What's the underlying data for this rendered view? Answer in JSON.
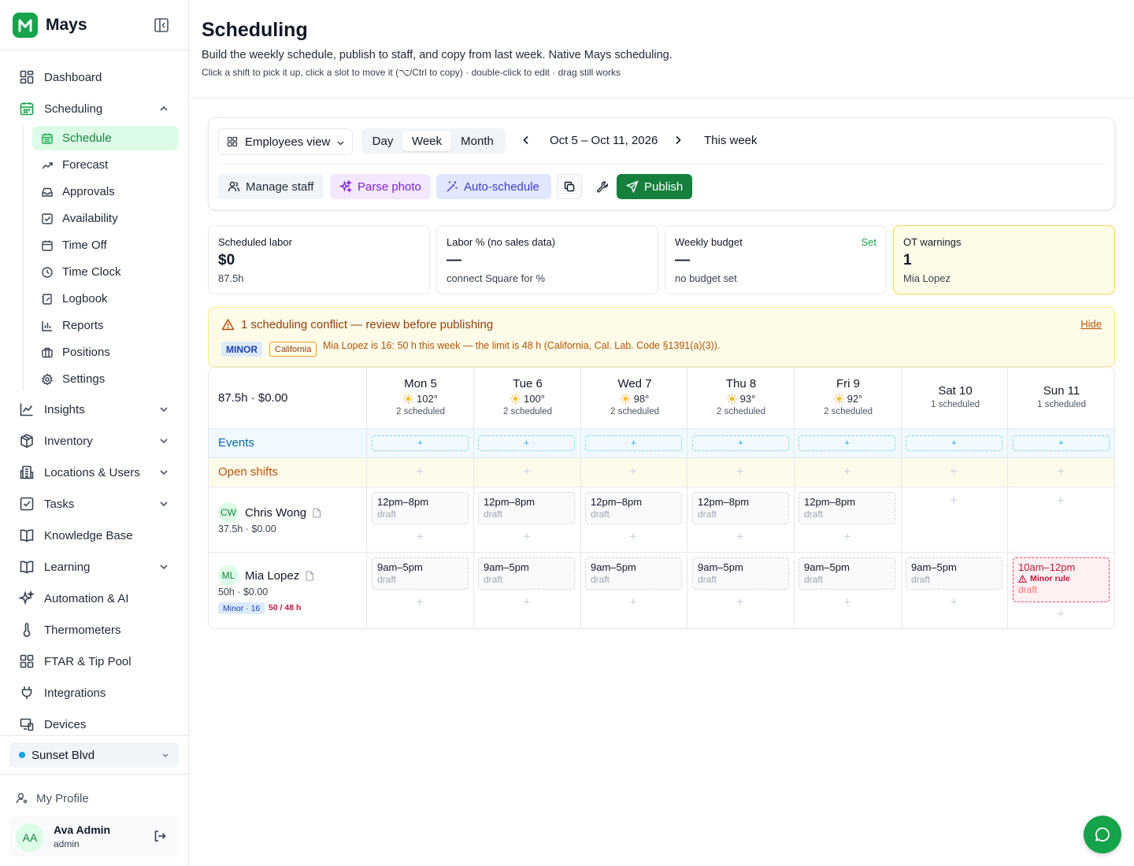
{
  "app": {
    "name": "Mays",
    "accent": "#16a34a"
  },
  "sidebar": {
    "items": [
      {
        "label": "Dashboard",
        "icon": "dashboard-icon"
      },
      {
        "label": "Scheduling",
        "icon": "calendar-icon",
        "expanded": true
      },
      {
        "label": "Insights",
        "icon": "chart-line-icon"
      },
      {
        "label": "Inventory",
        "icon": "box-icon"
      },
      {
        "label": "Locations & Users",
        "icon": "building-icon"
      },
      {
        "label": "Tasks",
        "icon": "checkbox-icon"
      },
      {
        "label": "Knowledge Base",
        "icon": "book-icon"
      },
      {
        "label": "Learning",
        "icon": "book-open-icon"
      },
      {
        "label": "Automation & AI",
        "icon": "sparkles-icon"
      },
      {
        "label": "Thermometers",
        "icon": "thermometer-icon"
      },
      {
        "label": "FTAR & Tip Pool",
        "icon": "grid-icon"
      },
      {
        "label": "Integrations",
        "icon": "plug-icon"
      },
      {
        "label": "Devices",
        "icon": "devices-icon"
      }
    ],
    "scheduling_sub": [
      {
        "label": "Schedule",
        "icon": "calendar-icon",
        "active": true
      },
      {
        "label": "Forecast",
        "icon": "trend-up-icon"
      },
      {
        "label": "Approvals",
        "icon": "inbox-icon"
      },
      {
        "label": "Availability",
        "icon": "checkbox-icon"
      },
      {
        "label": "Time Off",
        "icon": "calendar-icon"
      },
      {
        "label": "Time Clock",
        "icon": "clock-icon"
      },
      {
        "label": "Logbook",
        "icon": "notebook-icon"
      },
      {
        "label": "Reports",
        "icon": "bar-chart-icon"
      },
      {
        "label": "Positions",
        "icon": "briefcase-icon"
      },
      {
        "label": "Settings",
        "icon": "gear-icon"
      }
    ],
    "location": "Sunset Blvd",
    "my_profile": "My Profile",
    "user": {
      "initials": "AA",
      "name": "Ava Admin",
      "role": "admin"
    }
  },
  "page": {
    "title": "Scheduling",
    "subtitle": "Build the weekly schedule, publish to staff, and copy from last week. Native Mays scheduling.",
    "hint": "Click a shift to pick it up, click a slot to move it (⌥/Ctrl to copy) · double-click to edit · drag still works"
  },
  "toolbar": {
    "view": "Employees view",
    "modes": [
      "Day",
      "Week",
      "Month"
    ],
    "active_mode": "Week",
    "date_range": "Oct 5 – Oct 11, 2026",
    "this_week": "This week",
    "manage": "Manage staff",
    "parse": "Parse photo",
    "auto": "Auto-schedule",
    "publish": "Publish"
  },
  "stats": [
    {
      "label": "Scheduled labor",
      "value": "$0",
      "sub": "87.5h"
    },
    {
      "label": "Labor % (no sales data)",
      "value": "—",
      "sub": "connect Square for %"
    },
    {
      "label": "Weekly budget",
      "value": "—",
      "sub": "no budget set",
      "action": "Set"
    },
    {
      "label": "OT warnings",
      "value": "1",
      "sub": "Mia Lopez"
    }
  ],
  "conflict": {
    "title": "1 scheduling conflict — review before publishing",
    "hide": "Hide",
    "badge": "MINOR",
    "state": "California",
    "message": "Mia Lopez is 16: 50 h this week — the limit is 48 h (California, Cal. Lab. Code §1391(a)(3))."
  },
  "grid": {
    "total": "87.5h · $0.00",
    "days": [
      {
        "name": "Mon 5",
        "weather": "102°",
        "scheduled": "2 scheduled"
      },
      {
        "name": "Tue 6",
        "weather": "100°",
        "scheduled": "2 scheduled"
      },
      {
        "name": "Wed 7",
        "weather": "98°",
        "scheduled": "2 scheduled"
      },
      {
        "name": "Thu 8",
        "weather": "93°",
        "scheduled": "2 scheduled"
      },
      {
        "name": "Fri 9",
        "weather": "92°",
        "scheduled": "2 scheduled"
      },
      {
        "name": "Sat 10",
        "weather": "",
        "scheduled": "1 scheduled"
      },
      {
        "name": "Sun 11",
        "weather": "",
        "scheduled": "1 scheduled"
      }
    ],
    "events_label": "Events",
    "open_label": "Open shifts",
    "slot_plus": "+",
    "employees": [
      {
        "initials": "CW",
        "name": "Chris Wong",
        "meta": "37.5h · $0.00",
        "shifts": [
          {
            "time": "12pm–8pm",
            "status": "draft"
          },
          {
            "time": "12pm–8pm",
            "status": "draft"
          },
          {
            "time": "12pm–8pm",
            "status": "draft"
          },
          {
            "time": "12pm–8pm",
            "status": "draft"
          },
          {
            "time": "12pm–8pm",
            "status": "draft"
          },
          null,
          null
        ]
      },
      {
        "initials": "ML",
        "name": "Mia Lopez",
        "meta": "50h · $0.00",
        "minor": "Minor · 16",
        "hours_warn": "50 / 48 h",
        "shifts": [
          {
            "time": "9am–5pm",
            "status": "draft"
          },
          {
            "time": "9am–5pm",
            "status": "draft"
          },
          {
            "time": "9am–5pm",
            "status": "draft"
          },
          {
            "time": "9am–5pm",
            "status": "draft"
          },
          {
            "time": "9am–5pm",
            "status": "draft"
          },
          {
            "time": "9am–5pm",
            "status": "draft"
          },
          {
            "time": "10am–12pm",
            "status": "draft",
            "rule": "Minor rule"
          }
        ]
      }
    ]
  }
}
